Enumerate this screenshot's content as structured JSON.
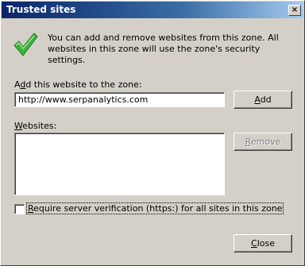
{
  "window": {
    "title": "Trusted sites",
    "close_glyph": "×"
  },
  "intro": {
    "icon": "green-checkmark-icon",
    "text": "You can add and remove websites from this zone. All websites in this zone will use the zone's security settings."
  },
  "add_section": {
    "label_prefix": "A",
    "label_accel": "d",
    "label_rest": "d this website to the zone:",
    "input_value": "http://www.serpanalytics.com",
    "add_button_accel": "A",
    "add_button_rest": "dd"
  },
  "websites": {
    "label_accel": "W",
    "label_rest": "ebsites:",
    "items": [],
    "remove_button_accel": "R",
    "remove_button_rest": "emove"
  },
  "verification": {
    "checked": false,
    "label_accel": "R",
    "label_rest": "equire server verification (https:) for all sites in this zone"
  },
  "footer": {
    "close_button_accel": "C",
    "close_button_rest": "lose"
  },
  "colors": {
    "titlebar_start": "#0a246a",
    "titlebar_end": "#a6caf0",
    "face": "#d4d0c8",
    "check_green": "#3cb43c"
  }
}
